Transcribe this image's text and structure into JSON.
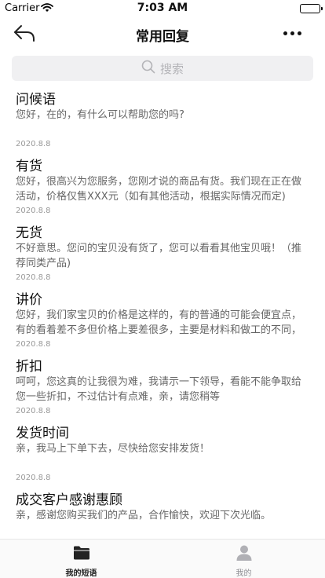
{
  "status_bar": {
    "carrier": "Carrier",
    "time": "7:03 AM",
    "battery_level": 1.0
  },
  "nav": {
    "title": "常用回复",
    "back_icon": "back-arrow-icon",
    "more_icon": "more-dots-icon"
  },
  "search": {
    "placeholder": "搜索",
    "icon": "search-icon"
  },
  "items": [
    {
      "title": "问候语",
      "content": "您好，在的，有什么可以帮助您的吗?",
      "date": "2020.8.8"
    },
    {
      "title": "有货",
      "content": "您好，很高兴为您服务，您刚才说的商品有货。我们现在正在做活动，价格仅售XXX元（如有其他活动，根据实际情况而定)",
      "date": "2020.8.8"
    },
    {
      "title": "无货",
      "content": "不好意思。您问的宝贝没有货了，您可以看看其他宝贝哦！（推荐同类产品)",
      "date": "2020.8.8"
    },
    {
      "title": "讲价",
      "content": "您好，我们家宝贝的价格是这样的，有的普通的可能会便宜点，有的看着差不多但价格上要差很多，主要是材料和做工的不同，",
      "date": "2020.8.8"
    },
    {
      "title": "折扣",
      "content": "呵呵，您这真的让我很为难，我请示一下领导，看能不能争取给您一些折扣，不过估计有点难，亲，请您稍等",
      "date": "2020.8.8"
    },
    {
      "title": "发货时间",
      "content": "亲，我马上下单下去，尽快给您安排发货！",
      "date": "2020.8.8"
    },
    {
      "title": "成交客户感谢惠顾",
      "content": "亲，感谢您购买我们的产品，合作愉快，欢迎下次光临。",
      "date": ""
    }
  ],
  "tabs": [
    {
      "label": "我的短语",
      "icon": "folder-icon",
      "active": true,
      "color": "#222222"
    },
    {
      "label": "我的",
      "icon": "person-icon",
      "active": false,
      "color": "#8e8e93"
    }
  ]
}
